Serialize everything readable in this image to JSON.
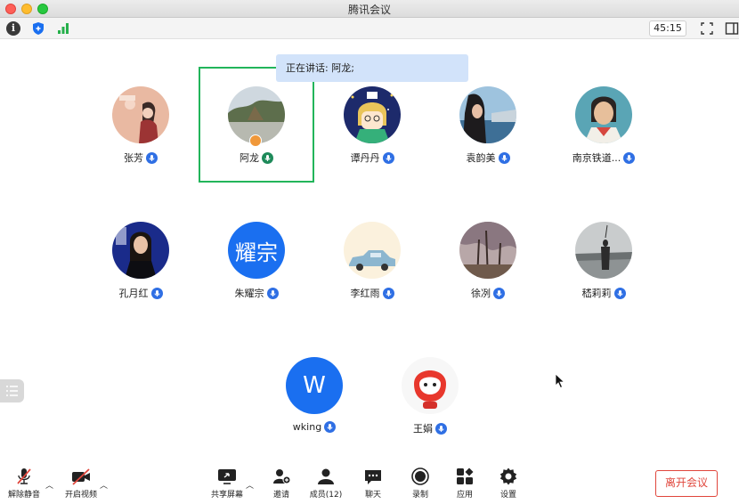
{
  "window": {
    "title": "腾讯会议"
  },
  "toolbar": {
    "timer": "45:15"
  },
  "speaking": {
    "text": "正在讲话: 阿龙;"
  },
  "participants": [
    {
      "name": "张芳"
    },
    {
      "name": "阿龙"
    },
    {
      "name": "谭丹丹"
    },
    {
      "name": "袁韵美"
    },
    {
      "name": "南京铁道..."
    },
    {
      "name": "孔月红"
    },
    {
      "name": "朱耀宗",
      "avatar_text": "耀宗"
    },
    {
      "name": "李红雨"
    },
    {
      "name": "徐冽"
    },
    {
      "name": "嵇莉莉"
    },
    {
      "name": "wking",
      "avatar_text": "W"
    },
    {
      "name": "王娟"
    }
  ],
  "bottombar": {
    "unmute": "解除静音",
    "video": "开启视频",
    "share": "共享屏幕",
    "invite": "邀请",
    "members": "成员(12)",
    "chat": "聊天",
    "record": "录制",
    "apps": "应用",
    "settings": "设置",
    "leave": "离开会议"
  },
  "colors": {
    "accent": "#1a6ff0",
    "speaker_frame": "#22b55a",
    "leave": "#e0463c",
    "banner": "#d2e3fa"
  }
}
